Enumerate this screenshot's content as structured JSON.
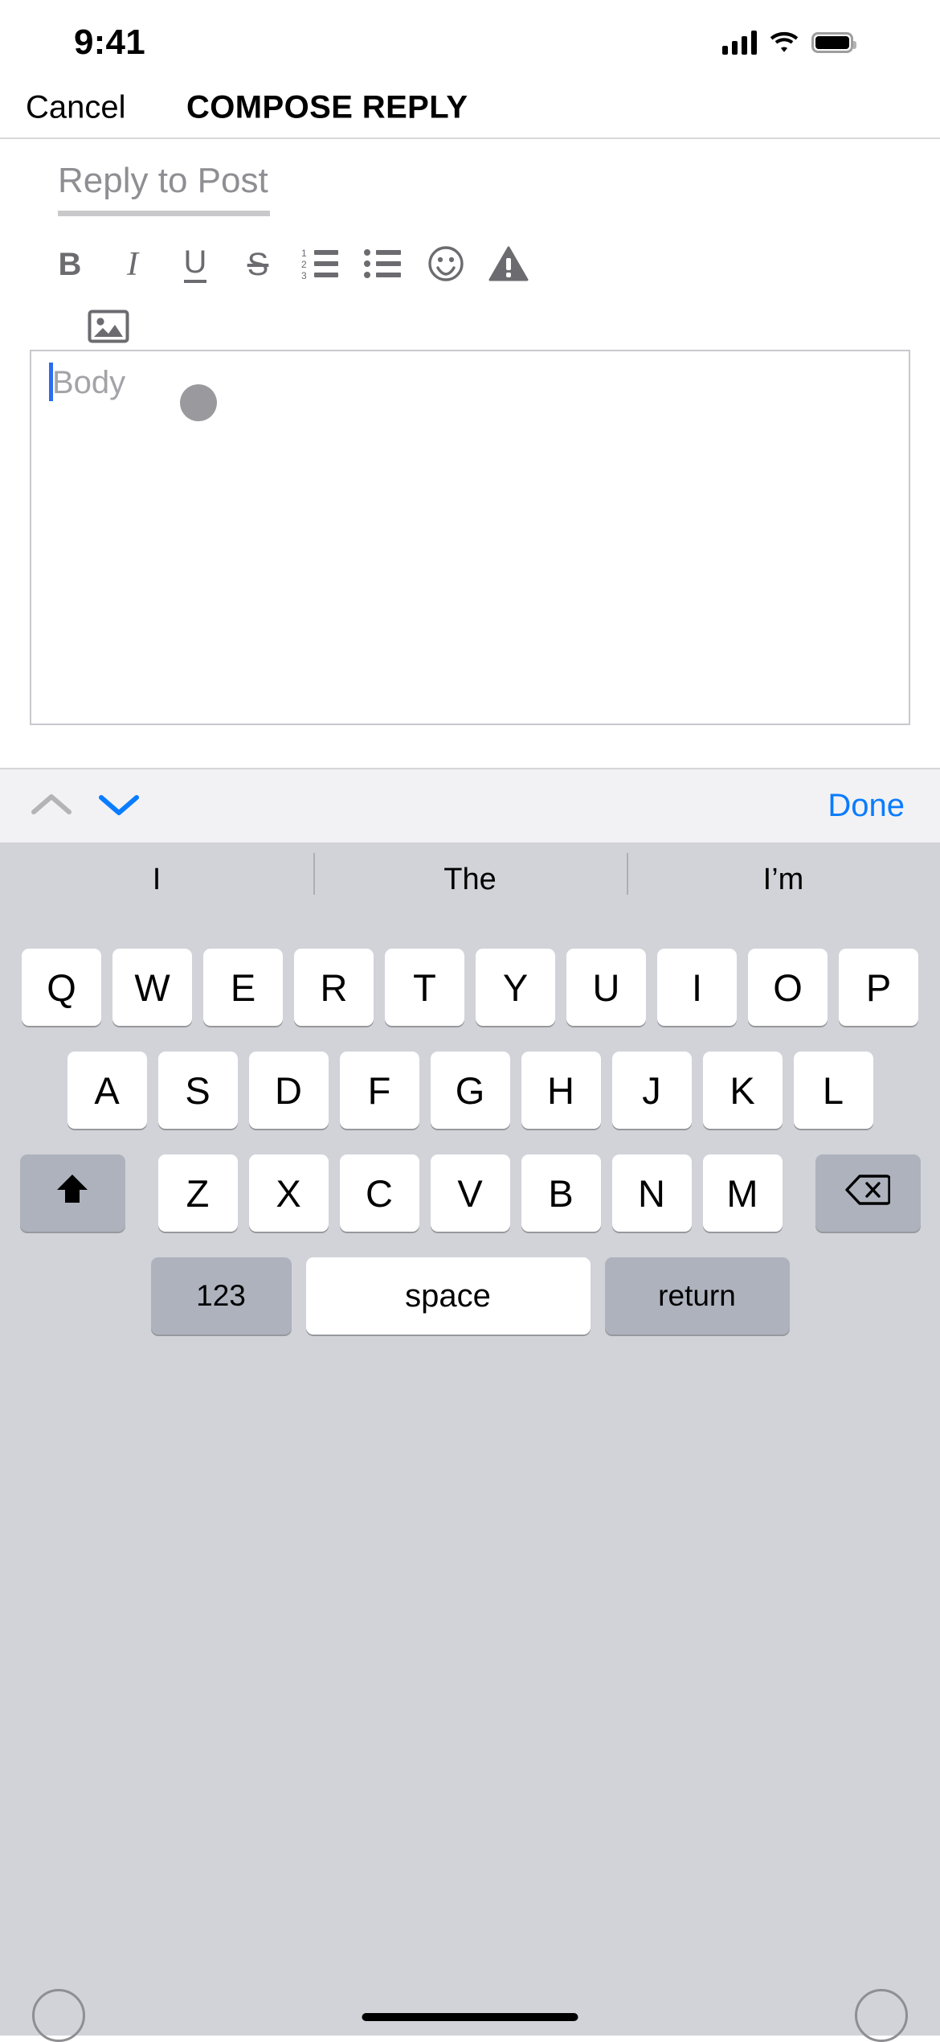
{
  "status_bar": {
    "time": "9:41",
    "signal_icon": "cellular-signal-icon",
    "wifi_icon": "wifi-icon",
    "battery_icon": "battery-icon"
  },
  "nav_bar": {
    "cancel_label": "Cancel",
    "title": "COMPOSE REPLY"
  },
  "compose": {
    "title_placeholder": "Reply to Post",
    "body_placeholder": "Body",
    "caret_color": "#2b6cf0",
    "toolbar": [
      {
        "name": "bold-button",
        "glyph": "B",
        "icon": "bold-icon"
      },
      {
        "name": "italic-button",
        "glyph": "I",
        "icon": "italic-icon"
      },
      {
        "name": "underline-button",
        "glyph": "U",
        "icon": "underline-icon"
      },
      {
        "name": "strikethrough-button",
        "glyph": "S",
        "icon": "strikethrough-icon"
      },
      {
        "name": "numbered-list-button",
        "glyph": "",
        "icon": "numbered-list-icon"
      },
      {
        "name": "bullet-list-button",
        "glyph": "",
        "icon": "bullet-list-icon"
      },
      {
        "name": "emoji-button",
        "glyph": "",
        "icon": "smiley-icon"
      },
      {
        "name": "warning-button",
        "glyph": "",
        "icon": "warning-triangle-icon"
      },
      {
        "name": "insert-image-button",
        "glyph": "",
        "icon": "image-icon"
      }
    ]
  },
  "keyboard_accessory": {
    "prev_label": "prev-field-chevron-up-icon",
    "next_label": "next-field-chevron-down-icon",
    "done_label": "Done",
    "done_color": "#0a7cff"
  },
  "predictive_bar": {
    "suggestions": [
      "I",
      "The",
      "I’m"
    ]
  },
  "keyboard": {
    "row1": [
      "Q",
      "W",
      "E",
      "R",
      "T",
      "Y",
      "U",
      "I",
      "O",
      "P"
    ],
    "row2": [
      "A",
      "S",
      "D",
      "F",
      "G",
      "H",
      "J",
      "K",
      "L"
    ],
    "row3": [
      "Z",
      "X",
      "C",
      "V",
      "B",
      "N",
      "M"
    ],
    "shift_label": "shift-icon",
    "backspace_label": "backspace-icon",
    "numbers_label": "123",
    "space_label": "space",
    "return_label": "return",
    "globe_label": "globe-icon",
    "mic_label": "microphone-icon"
  },
  "colors": {
    "keyboard_bg": "#d1d3d9",
    "key_bg": "#ffffff",
    "modifier_key_bg": "#adb2bd",
    "accent": "#0a7cff",
    "toolbar_icon": "#6b6b70",
    "placeholder": "#8e8e93"
  }
}
